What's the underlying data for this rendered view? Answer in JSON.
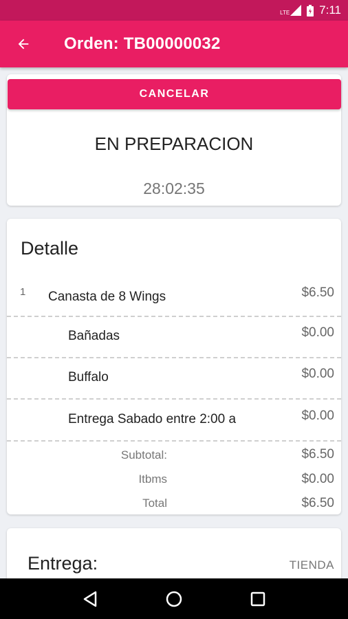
{
  "status_bar": {
    "network_label": "LTE",
    "time": "7:11"
  },
  "app_bar": {
    "title": "Orden: TB00000032",
    "back_icon": "arrow-back-icon"
  },
  "status_card": {
    "cancel_label": "CANCELAR",
    "order_status": "EN PREPARACION",
    "timer": "28:02:35"
  },
  "detail": {
    "title": "Detalle",
    "items": [
      {
        "qty": "1",
        "name": "Canasta de 8 Wings",
        "price": "$6.50"
      },
      {
        "qty": "",
        "name": "Bañadas",
        "price": "$0.00"
      },
      {
        "qty": "",
        "name": "Buffalo",
        "price": "$0.00"
      },
      {
        "qty": "",
        "name": "Entrega Sabado entre 2:00 a",
        "price": "$0.00"
      }
    ],
    "totals": [
      {
        "label": "Subtotal:",
        "value": "$6.50"
      },
      {
        "label": "Itbms",
        "value": "$0.00"
      },
      {
        "label": "Total",
        "value": "$6.50"
      }
    ]
  },
  "delivery": {
    "label": "Entrega:",
    "value": "TIENDA"
  },
  "nav_bar": {
    "back": "nav-back-icon",
    "home": "nav-home-icon",
    "recents": "nav-recents-icon"
  },
  "colors": {
    "primary": "#e91e63",
    "primary_dark": "#c2185b"
  }
}
